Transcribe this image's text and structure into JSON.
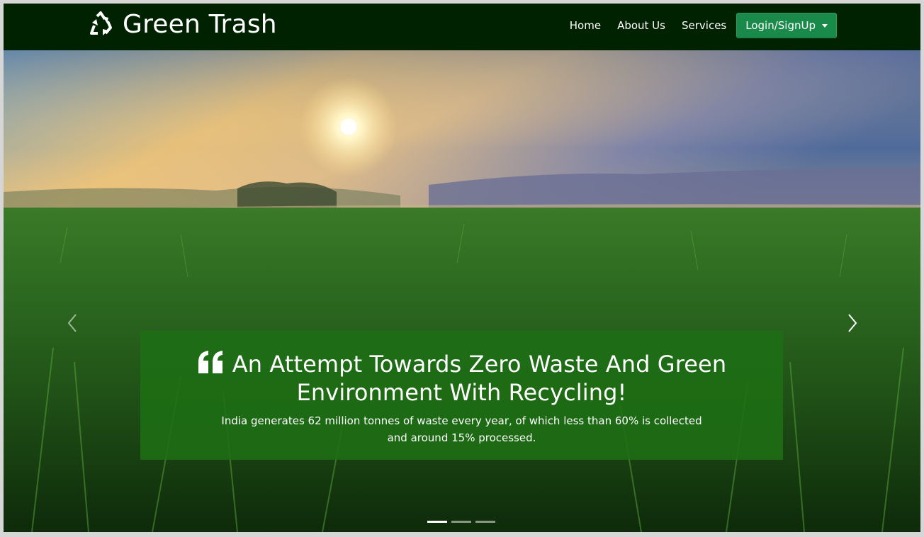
{
  "brand": {
    "name": "Green Trash",
    "icon": "recycle-icon"
  },
  "nav": {
    "items": [
      {
        "label": "Home"
      },
      {
        "label": "About Us"
      },
      {
        "label": "Services"
      }
    ],
    "login_label": "Login/SignUp"
  },
  "hero": {
    "heading": "An Attempt Towards Zero Waste And Green Environment With Recycling!",
    "subtext": "India generates 62 million tonnes of waste every year, of which less than 60% is collected and around 15% processed.",
    "quote_icon": "quote-left-icon",
    "prev_icon": "chevron-left-icon",
    "next_icon": "chevron-right-icon",
    "slides_count": 3,
    "active_slide": 1
  },
  "colors": {
    "navbar_bg": "#002200",
    "login_button": "#1a8a4a",
    "caption_bg": "#1e6e14"
  }
}
